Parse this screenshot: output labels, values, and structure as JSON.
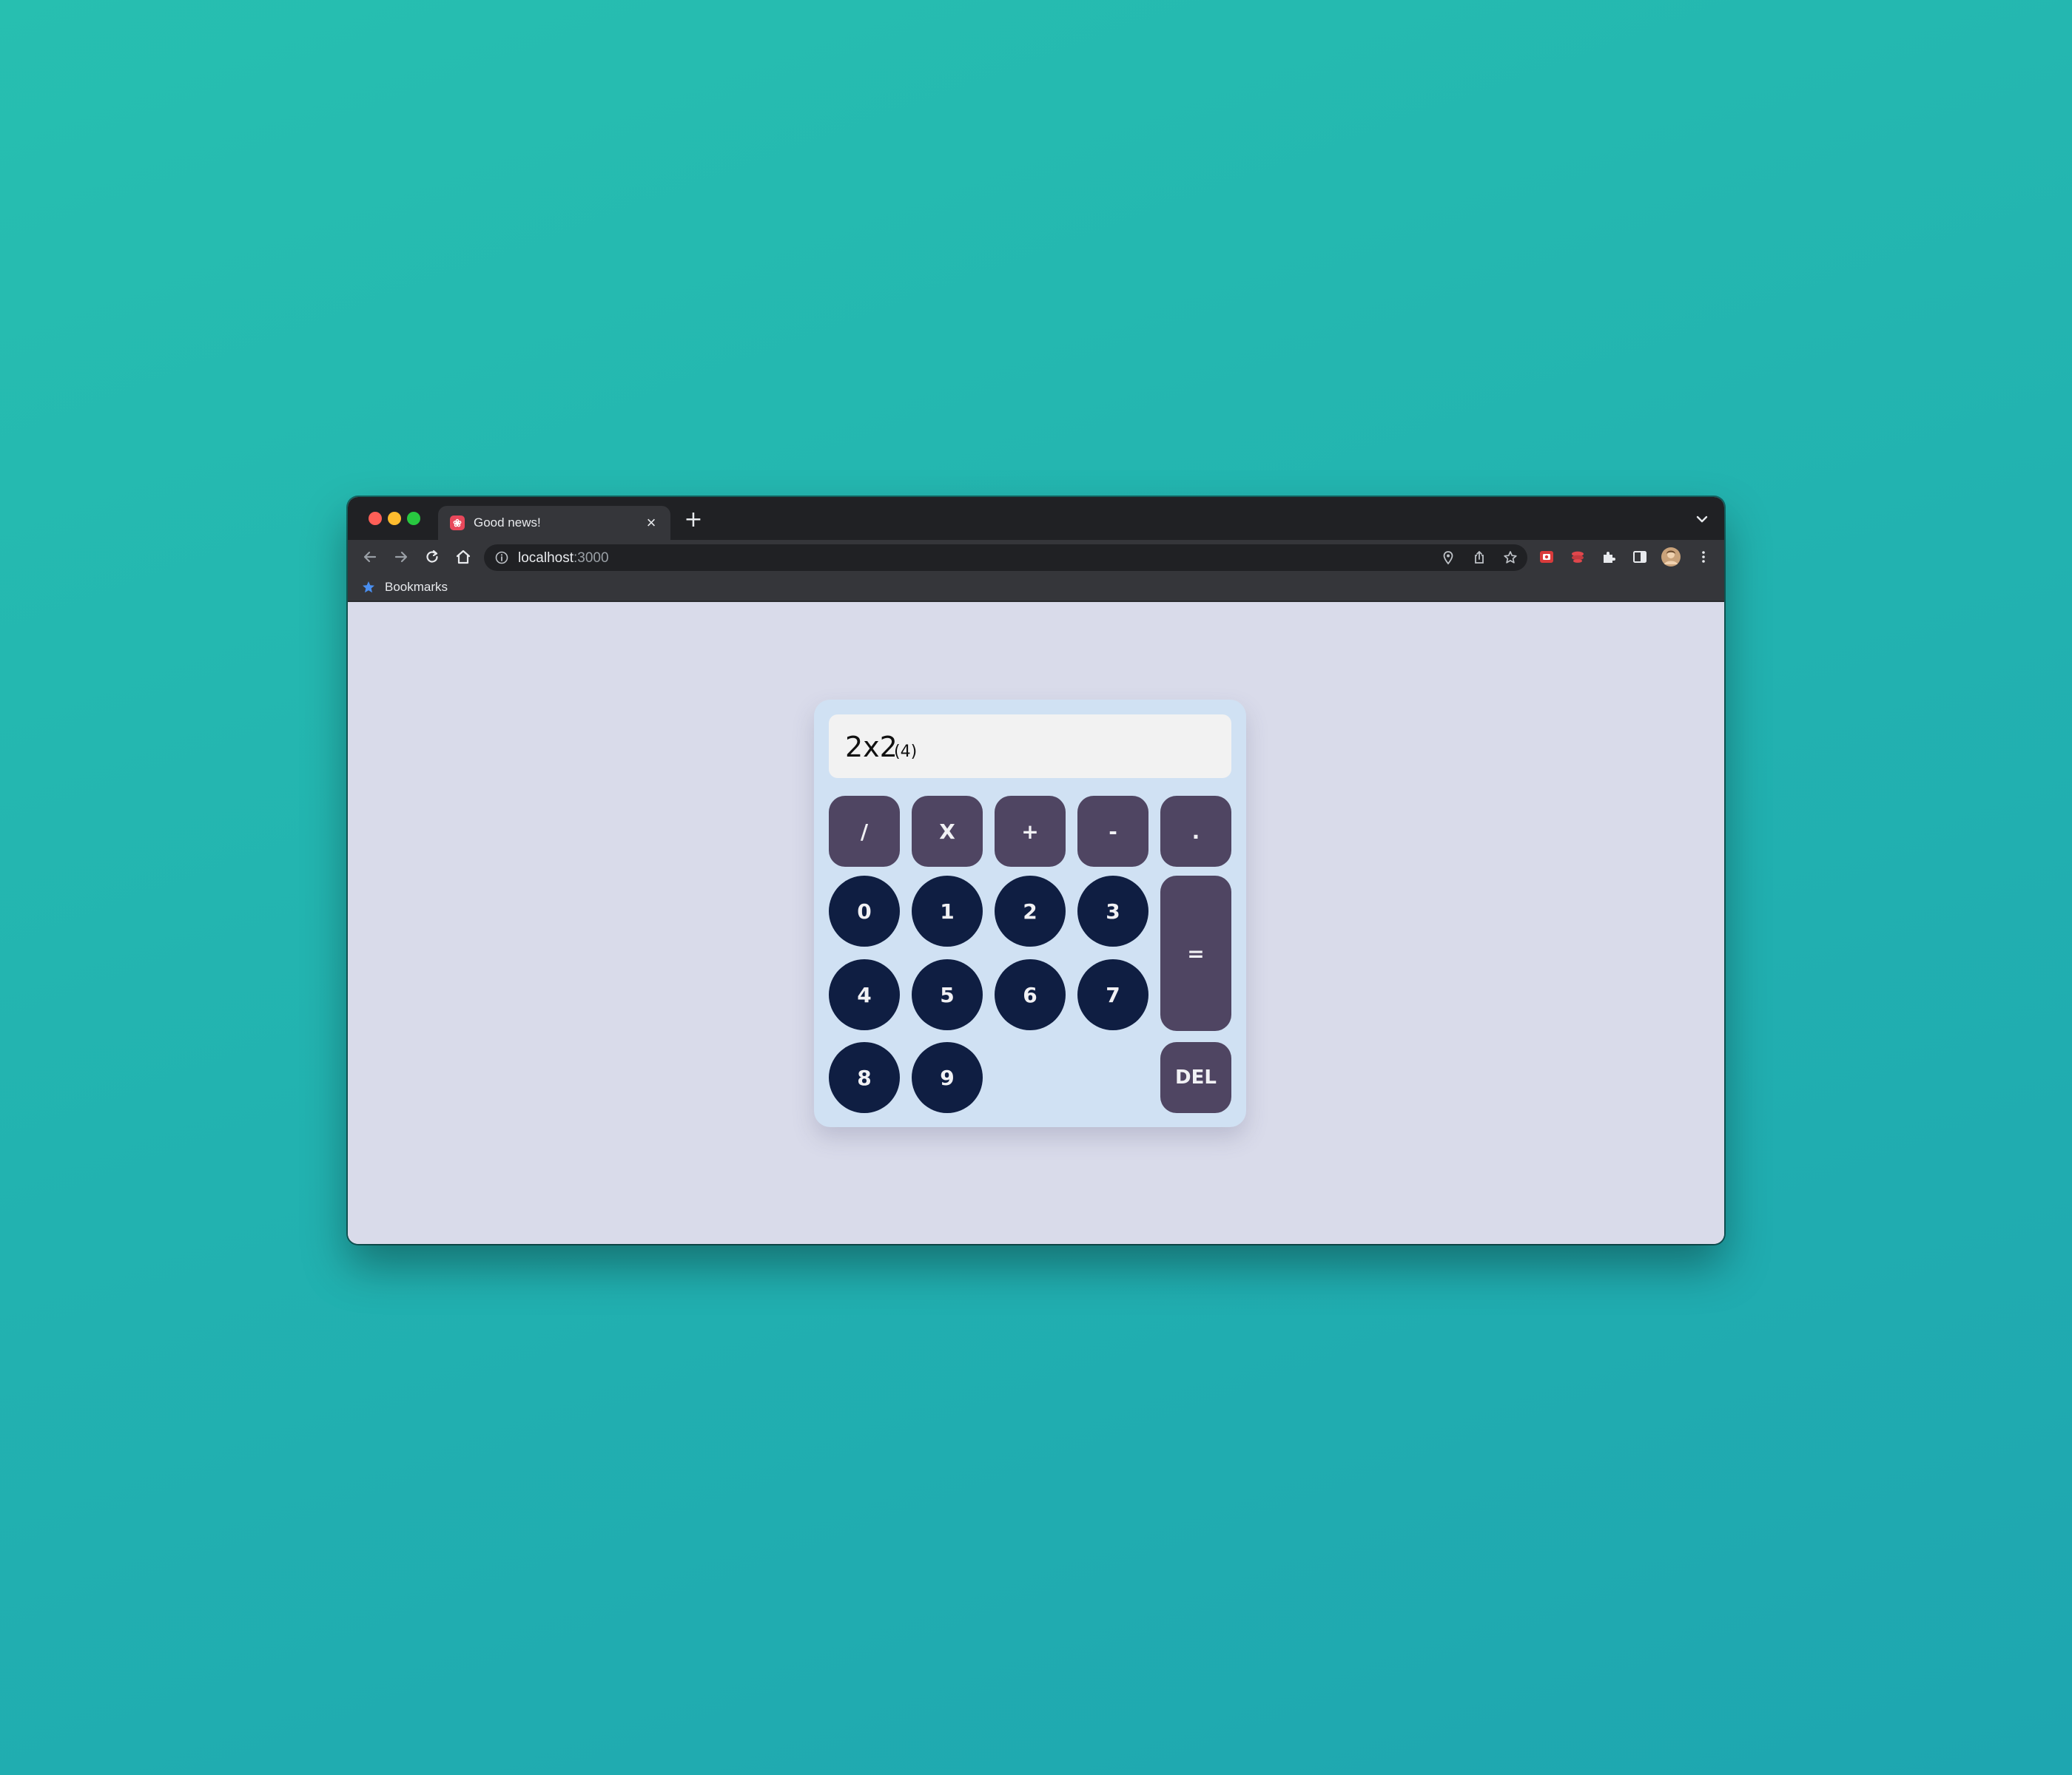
{
  "browser": {
    "tab": {
      "title": "Good news!",
      "favicon": "gift-icon",
      "close_label": "×"
    },
    "new_tab_label": "+",
    "url_host": "localhost",
    "url_port": ":3000",
    "bookmarks_label": "Bookmarks",
    "profile_avatar": "avatar"
  },
  "calculator": {
    "expression": "2x2",
    "result": "(4)",
    "operators": {
      "divide": "/",
      "multiply": "X",
      "add": "+",
      "subtract": "-",
      "decimal": "."
    },
    "digits": [
      "0",
      "1",
      "2",
      "3",
      "4",
      "5",
      "6",
      "7",
      "8",
      "9"
    ],
    "equals": "=",
    "delete": "DEL"
  },
  "colors": {
    "background": "#24b5b0",
    "page": "#d9dbea",
    "calculator_body": "#d0e1f3",
    "display": "#f2f2f2",
    "operator_key": "#4f4562",
    "digit_key": "#0f1e42",
    "key_text": "#f1f1f4"
  }
}
